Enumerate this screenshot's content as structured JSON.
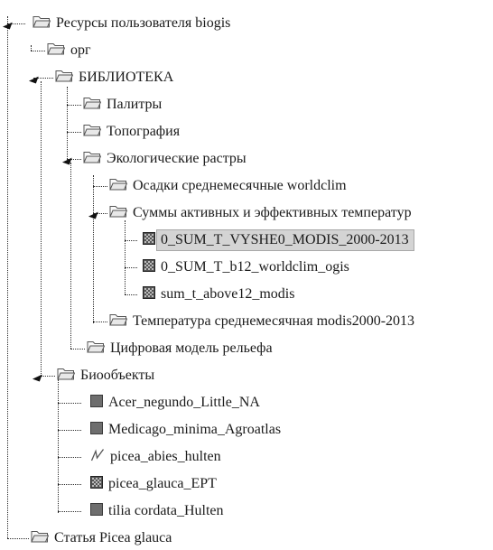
{
  "tree": {
    "root": {
      "label": "Ресурсы пользователя biogis",
      "icon": "folder-icon",
      "expanded": true
    },
    "nodes": [
      {
        "label": "орг",
        "icon": "folder-icon"
      },
      {
        "label": "БИБЛИОТЕКА",
        "icon": "folder-icon",
        "expanded": true
      },
      {
        "label": "Палитры",
        "icon": "folder-icon"
      },
      {
        "label": "Топография",
        "icon": "folder-icon"
      },
      {
        "label": "Экологические растры",
        "icon": "folder-icon",
        "expanded": true
      },
      {
        "label": "Осадки среднемесячные worldclim",
        "icon": "folder-icon"
      },
      {
        "label": "Суммы активных и эффективных температур",
        "icon": "folder-icon",
        "expanded": true
      },
      {
        "label": "0_SUM_T_VYSHE0_MODIS_2000-2013",
        "icon": "raster-layer-icon",
        "selected": true
      },
      {
        "label": "0_SUM_T_b12_worldclim_ogis",
        "icon": "raster-layer-icon"
      },
      {
        "label": "sum_t_above12_modis",
        "icon": "raster-layer-icon"
      },
      {
        "label": "Температура среднемесячная modis2000-2013",
        "icon": "folder-icon"
      },
      {
        "label": "Цифровая модель рельефа",
        "icon": "folder-icon"
      },
      {
        "label": "Биообъекты",
        "icon": "folder-icon",
        "expanded": true
      },
      {
        "label": "Acer_negundo_Little_NA",
        "icon": "polygon-layer-icon"
      },
      {
        "label": "Medicago_minima_Agroatlas",
        "icon": "polygon-layer-icon"
      },
      {
        "label": "picea_abies_hulten",
        "icon": "line-layer-icon"
      },
      {
        "label": "picea_glauca_EPT",
        "icon": "raster-layer-icon"
      },
      {
        "label": "tilia cordata_Hulten",
        "icon": "polygon-layer-icon"
      },
      {
        "label": "Статья Picea glauca",
        "icon": "folder-icon"
      }
    ]
  },
  "colors": {
    "selection_bg": "#d4d4d4",
    "folder_stroke": "#555555",
    "layer_fill": "#6e6e6e"
  }
}
